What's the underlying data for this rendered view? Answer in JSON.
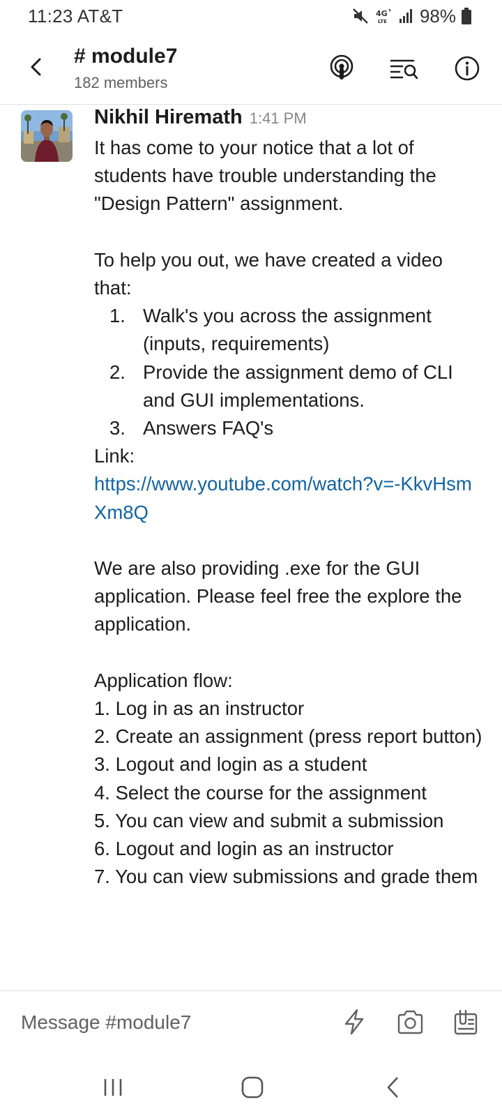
{
  "status_bar": {
    "time": "11:23 AT&T",
    "battery": "98%",
    "network": "4G LTE",
    "icons": [
      "mute-icon",
      "lte-icon",
      "signal-icon",
      "battery-icon"
    ]
  },
  "header": {
    "channel": "# module7",
    "members": "182 members",
    "icons": [
      "back-arrow-icon",
      "huddle-icon",
      "search-messages-icon",
      "info-icon"
    ]
  },
  "message": {
    "sender": "Nikhil Hiremath",
    "time": "1:41 PM",
    "intro": "It has come to your notice that a lot of students have trouble understanding the \"Design Pattern\" assignment.",
    "help_text": "To help you out, we have created a video that:",
    "video_points": [
      {
        "num": "1.",
        "text": "Walk's you across the assignment (inputs, requirements)"
      },
      {
        "num": "2.",
        "text": "Provide the assignment demo of CLI and GUI implementations."
      },
      {
        "num": "3.",
        "text": "Answers FAQ's"
      }
    ],
    "link_label": "Link:",
    "link_url": "https://www.youtube.com/watch?v=-KkvHsmXm8Q",
    "exe_text": "We are also providing .exe for the GUI application. Please feel free the explore the application.",
    "flow_title": "Application flow:",
    "flow_steps": [
      "1. Log in as an instructor",
      "2. Create an assignment (press report button)",
      "3. Logout and login as a student",
      "4. Select the course for the assignment",
      "5. You can view and submit a submission",
      "6. Logout and login as an instructor",
      "7. You can view submissions and grade them"
    ]
  },
  "composer": {
    "placeholder": "Message #module7",
    "icons": [
      "shortcut-bolt-icon",
      "camera-icon",
      "attachment-icon"
    ]
  },
  "nav": {
    "icons": [
      "recents-icon",
      "home-icon",
      "back-icon"
    ]
  },
  "colors": {
    "link": "#1264a3",
    "text": "#1d1c1d",
    "muted": "#616061",
    "divider": "#dddddd"
  }
}
